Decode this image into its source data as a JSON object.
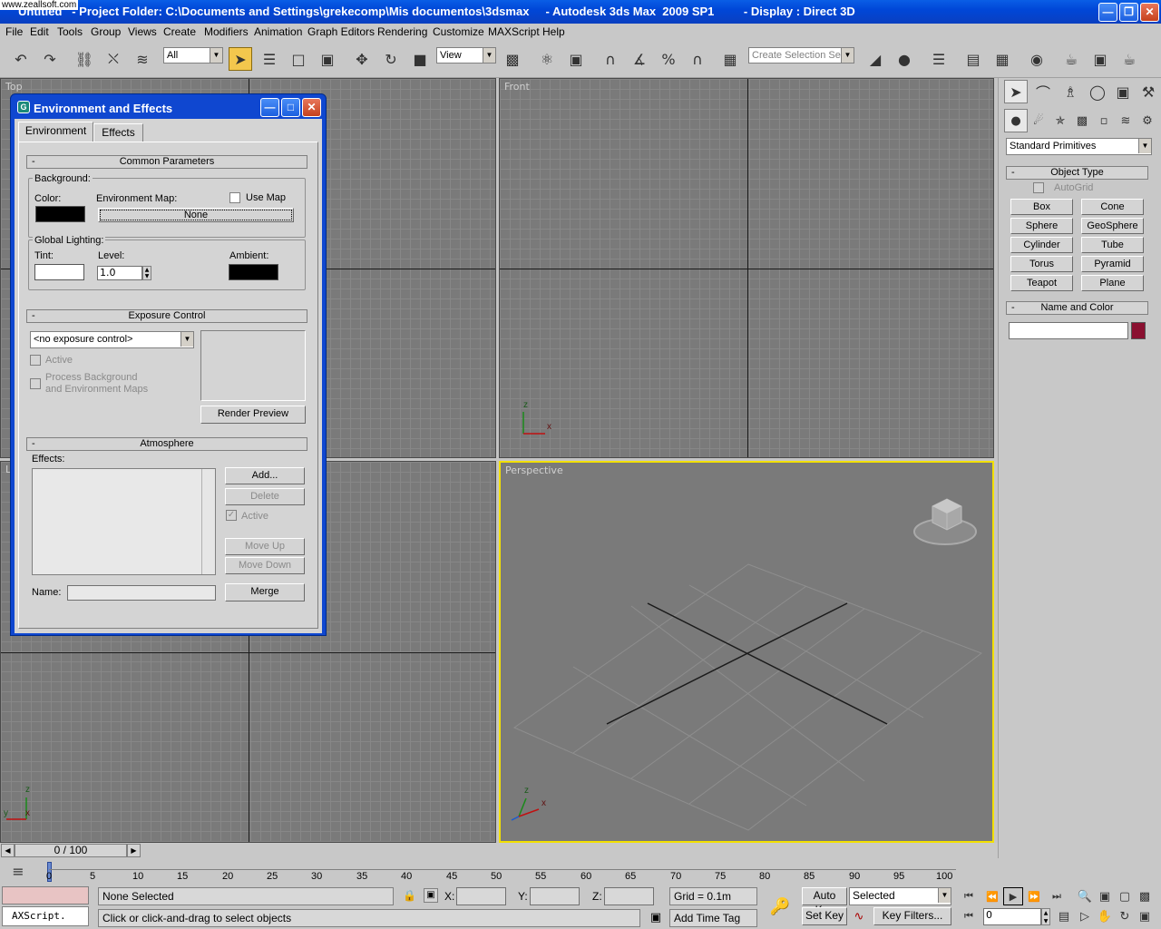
{
  "window": {
    "title": "Untitled   - Project Folder: C:\\Documents and Settings\\grekecomp\\Mis documentos\\3dsmax     - Autodesk 3ds Max  2009 SP1         - Display : Direct 3D",
    "watermark": "www.zeallsoft.com"
  },
  "menu": [
    "File",
    "Edit",
    "Tools",
    "Group",
    "Views",
    "Create",
    "Modifiers",
    "Animation",
    "Graph Editors",
    "Rendering",
    "Customize",
    "MAXScript",
    "Help"
  ],
  "toolbar": {
    "filter": "All",
    "coord": "View",
    "selection_set": "Create Selection Set"
  },
  "viewports": {
    "top": "Top",
    "front": "Front",
    "left": "Left",
    "perspective": "Perspective",
    "axis_z": "z",
    "axis_x": "x",
    "axis_y": "y"
  },
  "command_panel": {
    "category": "Standard Primitives",
    "object_type": "Object Type",
    "autogrid": "AutoGrid",
    "buttons": [
      "Box",
      "Cone",
      "Sphere",
      "GeoSphere",
      "Cylinder",
      "Tube",
      "Torus",
      "Pyramid",
      "Teapot",
      "Plane"
    ],
    "name_and_color": "Name and Color",
    "object_color": "#8a1030"
  },
  "dialog": {
    "title": "Environment and Effects",
    "tabs": [
      "Environment",
      "Effects"
    ],
    "common": {
      "header": "Common Parameters",
      "background": "Background:",
      "color": "Color:",
      "env_map": "Environment Map:",
      "use_map": "Use Map",
      "none": "None",
      "global_lighting": "Global Lighting:",
      "tint": "Tint:",
      "level": "Level:",
      "level_value": "1.0",
      "ambient": "Ambient:"
    },
    "exposure": {
      "header": "Exposure Control",
      "select": "<no exposure control>",
      "active": "Active",
      "process_bg": "Process Background",
      "env_maps": "and Environment Maps",
      "render_preview": "Render Preview"
    },
    "atmosphere": {
      "header": "Atmosphere",
      "effects": "Effects:",
      "add": "Add...",
      "delete": "Delete",
      "active": "Active",
      "move_up": "Move Up",
      "move_down": "Move Down",
      "name": "Name:",
      "merge": "Merge"
    }
  },
  "timeline": {
    "frame": "0 / 100",
    "ticks": [
      "0",
      "5",
      "10",
      "15",
      "20",
      "25",
      "30",
      "35",
      "40",
      "45",
      "50",
      "55",
      "60",
      "65",
      "70",
      "75",
      "80",
      "85",
      "90",
      "95",
      "100"
    ]
  },
  "status": {
    "script": "AXScript.",
    "selection": "None Selected",
    "prompt": "Click or click-and-drag to select objects",
    "x": "X:",
    "y": "Y:",
    "z": "Z:",
    "grid": "Grid = 0.1m",
    "add_time_tag": "Add Time Tag",
    "auto_key": "Auto Key",
    "set_key": "Set Key",
    "selected": "Selected",
    "key_filters": "Key Filters...",
    "frame": "0"
  }
}
